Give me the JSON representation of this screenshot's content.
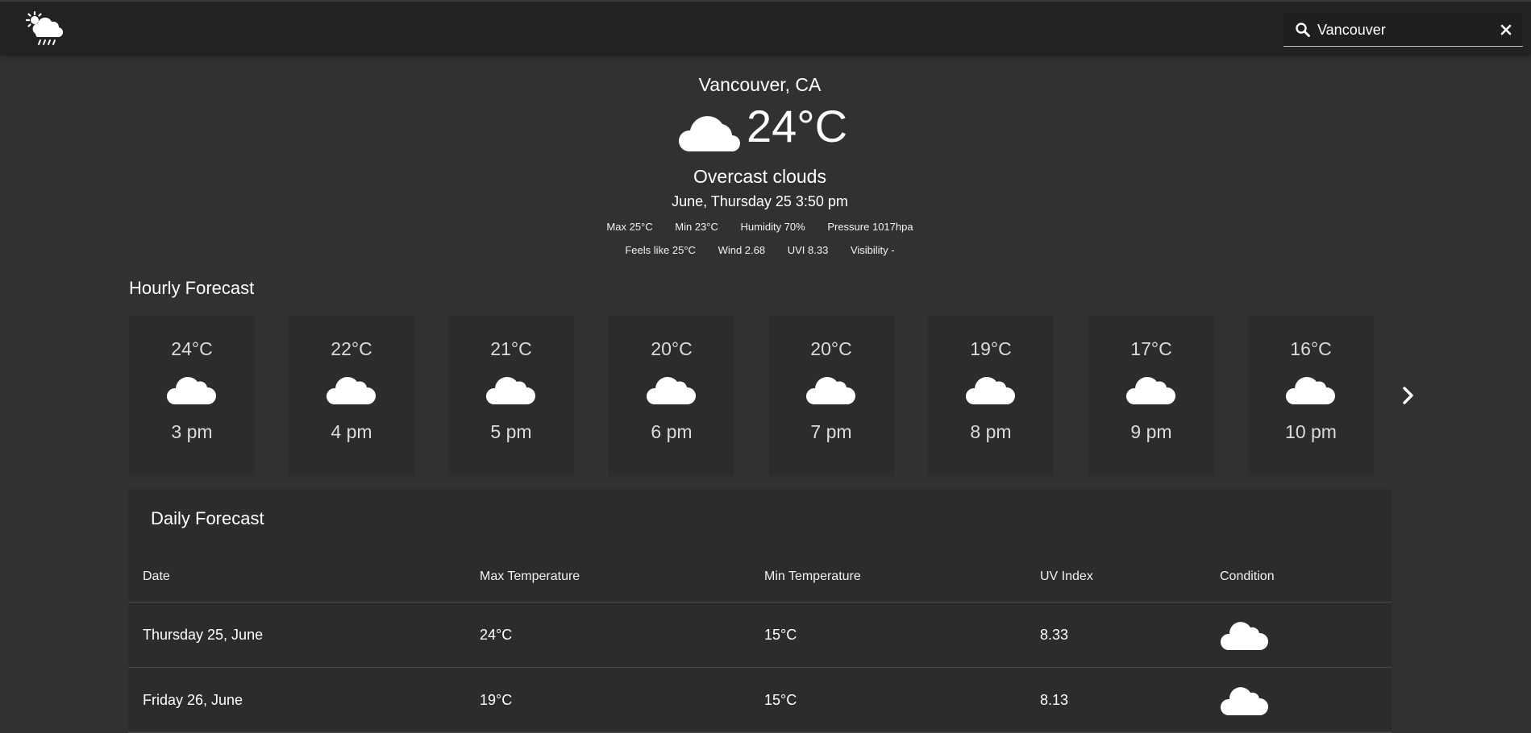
{
  "header": {
    "logo_icon": "sun-cloud-rain-icon",
    "search": {
      "value": "Vancouver",
      "icon": "search-icon",
      "clear_icon": "close-icon"
    }
  },
  "current": {
    "city": "Vancouver, CA",
    "icon": "cloud-icon",
    "temperature": "24°C",
    "description": "Overcast clouds",
    "datetime": "June, Thursday 25 3:50 pm",
    "stats_row1": [
      "Max 25°C",
      "Min 23°C",
      "Humidity 70%",
      "Pressure 1017hpa"
    ],
    "stats_row2": [
      "Feels like 25°C",
      "Wind 2.68",
      "UVI 8.33",
      "Visibility -"
    ]
  },
  "hourly": {
    "title": "Hourly Forecast",
    "items": [
      {
        "temp": "24°C",
        "time": "3 pm",
        "icon": "cloud-icon"
      },
      {
        "temp": "22°C",
        "time": "4 pm",
        "icon": "cloud-icon"
      },
      {
        "temp": "21°C",
        "time": "5 pm",
        "icon": "cloud-icon"
      },
      {
        "temp": "20°C",
        "time": "6 pm",
        "icon": "cloud-icon"
      },
      {
        "temp": "20°C",
        "time": "7 pm",
        "icon": "cloud-icon"
      },
      {
        "temp": "19°C",
        "time": "8 pm",
        "icon": "cloud-icon"
      },
      {
        "temp": "17°C",
        "time": "9 pm",
        "icon": "cloud-icon"
      },
      {
        "temp": "16°C",
        "time": "10 pm",
        "icon": "cloud-icon"
      }
    ],
    "next_icon": "chevron-right-icon"
  },
  "daily": {
    "title": "Daily Forecast",
    "columns": [
      "Date",
      "Max Temperature",
      "Min Temperature",
      "UV Index",
      "Condition"
    ],
    "rows": [
      {
        "date": "Thursday 25, June",
        "max": "24°C",
        "min": "15°C",
        "uv": "8.33",
        "icon": "cloud-icon"
      },
      {
        "date": "Friday 26, June",
        "max": "19°C",
        "min": "15°C",
        "uv": "8.13",
        "icon": "cloud-icon"
      }
    ]
  },
  "colors": {
    "background": "#313133",
    "topbar": "#222222",
    "card": "#2c2c2e",
    "text": "#ffffff"
  }
}
